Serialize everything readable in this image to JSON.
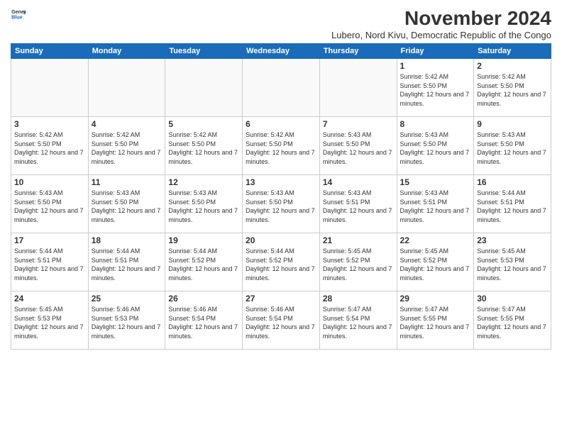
{
  "logo": {
    "general": "General",
    "blue": "Blue"
  },
  "header": {
    "month": "November 2024",
    "location": "Lubero, Nord Kivu, Democratic Republic of the Congo"
  },
  "weekdays": [
    "Sunday",
    "Monday",
    "Tuesday",
    "Wednesday",
    "Thursday",
    "Friday",
    "Saturday"
  ],
  "weeks": [
    [
      {
        "day": "",
        "empty": true
      },
      {
        "day": "",
        "empty": true
      },
      {
        "day": "",
        "empty": true
      },
      {
        "day": "",
        "empty": true
      },
      {
        "day": "",
        "empty": true
      },
      {
        "day": "1",
        "sunrise": "5:42 AM",
        "sunset": "5:50 PM",
        "daylight": "12 hours and 7 minutes."
      },
      {
        "day": "2",
        "sunrise": "5:42 AM",
        "sunset": "5:50 PM",
        "daylight": "12 hours and 7 minutes."
      }
    ],
    [
      {
        "day": "3",
        "sunrise": "5:42 AM",
        "sunset": "5:50 PM",
        "daylight": "12 hours and 7 minutes."
      },
      {
        "day": "4",
        "sunrise": "5:42 AM",
        "sunset": "5:50 PM",
        "daylight": "12 hours and 7 minutes."
      },
      {
        "day": "5",
        "sunrise": "5:42 AM",
        "sunset": "5:50 PM",
        "daylight": "12 hours and 7 minutes."
      },
      {
        "day": "6",
        "sunrise": "5:42 AM",
        "sunset": "5:50 PM",
        "daylight": "12 hours and 7 minutes."
      },
      {
        "day": "7",
        "sunrise": "5:43 AM",
        "sunset": "5:50 PM",
        "daylight": "12 hours and 7 minutes."
      },
      {
        "day": "8",
        "sunrise": "5:43 AM",
        "sunset": "5:50 PM",
        "daylight": "12 hours and 7 minutes."
      },
      {
        "day": "9",
        "sunrise": "5:43 AM",
        "sunset": "5:50 PM",
        "daylight": "12 hours and 7 minutes."
      }
    ],
    [
      {
        "day": "10",
        "sunrise": "5:43 AM",
        "sunset": "5:50 PM",
        "daylight": "12 hours and 7 minutes."
      },
      {
        "day": "11",
        "sunrise": "5:43 AM",
        "sunset": "5:50 PM",
        "daylight": "12 hours and 7 minutes."
      },
      {
        "day": "12",
        "sunrise": "5:43 AM",
        "sunset": "5:50 PM",
        "daylight": "12 hours and 7 minutes."
      },
      {
        "day": "13",
        "sunrise": "5:43 AM",
        "sunset": "5:50 PM",
        "daylight": "12 hours and 7 minutes."
      },
      {
        "day": "14",
        "sunrise": "5:43 AM",
        "sunset": "5:51 PM",
        "daylight": "12 hours and 7 minutes."
      },
      {
        "day": "15",
        "sunrise": "5:43 AM",
        "sunset": "5:51 PM",
        "daylight": "12 hours and 7 minutes."
      },
      {
        "day": "16",
        "sunrise": "5:44 AM",
        "sunset": "5:51 PM",
        "daylight": "12 hours and 7 minutes."
      }
    ],
    [
      {
        "day": "17",
        "sunrise": "5:44 AM",
        "sunset": "5:51 PM",
        "daylight": "12 hours and 7 minutes."
      },
      {
        "day": "18",
        "sunrise": "5:44 AM",
        "sunset": "5:51 PM",
        "daylight": "12 hours and 7 minutes."
      },
      {
        "day": "19",
        "sunrise": "5:44 AM",
        "sunset": "5:52 PM",
        "daylight": "12 hours and 7 minutes."
      },
      {
        "day": "20",
        "sunrise": "5:44 AM",
        "sunset": "5:52 PM",
        "daylight": "12 hours and 7 minutes."
      },
      {
        "day": "21",
        "sunrise": "5:45 AM",
        "sunset": "5:52 PM",
        "daylight": "12 hours and 7 minutes."
      },
      {
        "day": "22",
        "sunrise": "5:45 AM",
        "sunset": "5:52 PM",
        "daylight": "12 hours and 7 minutes."
      },
      {
        "day": "23",
        "sunrise": "5:45 AM",
        "sunset": "5:53 PM",
        "daylight": "12 hours and 7 minutes."
      }
    ],
    [
      {
        "day": "24",
        "sunrise": "5:45 AM",
        "sunset": "5:53 PM",
        "daylight": "12 hours and 7 minutes."
      },
      {
        "day": "25",
        "sunrise": "5:46 AM",
        "sunset": "5:53 PM",
        "daylight": "12 hours and 7 minutes."
      },
      {
        "day": "26",
        "sunrise": "5:46 AM",
        "sunset": "5:54 PM",
        "daylight": "12 hours and 7 minutes."
      },
      {
        "day": "27",
        "sunrise": "5:46 AM",
        "sunset": "5:54 PM",
        "daylight": "12 hours and 7 minutes."
      },
      {
        "day": "28",
        "sunrise": "5:47 AM",
        "sunset": "5:54 PM",
        "daylight": "12 hours and 7 minutes."
      },
      {
        "day": "29",
        "sunrise": "5:47 AM",
        "sunset": "5:55 PM",
        "daylight": "12 hours and 7 minutes."
      },
      {
        "day": "30",
        "sunrise": "5:47 AM",
        "sunset": "5:55 PM",
        "daylight": "12 hours and 7 minutes."
      }
    ]
  ]
}
